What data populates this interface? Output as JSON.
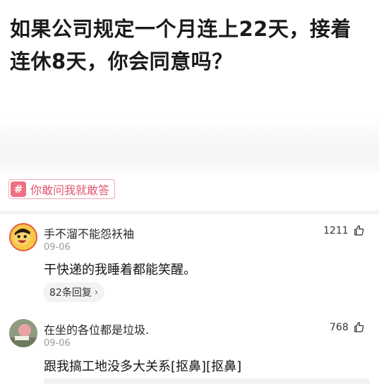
{
  "question": {
    "line1": "如果公司规定一个月连上22天，接着",
    "line2": "连休8天，你会同意吗？"
  },
  "topic_tag": {
    "icon": "hash-icon",
    "icon_glyph": "#",
    "label": "你敢问我就敢答"
  },
  "comments": [
    {
      "user": "手不溜不能怨袄袖",
      "date": "09-06",
      "text": "干快递的我睡着都能笑醒。",
      "likes": "1211",
      "replies": "82条回复"
    },
    {
      "user": "在坐的各位都是垃圾.",
      "date": "09-06",
      "text": "跟我搞工地没多大关系[抠鼻][抠鼻]",
      "likes": "768"
    }
  ],
  "colors": {
    "accent": "#ee6f82",
    "tag_text": "#e2566c"
  }
}
